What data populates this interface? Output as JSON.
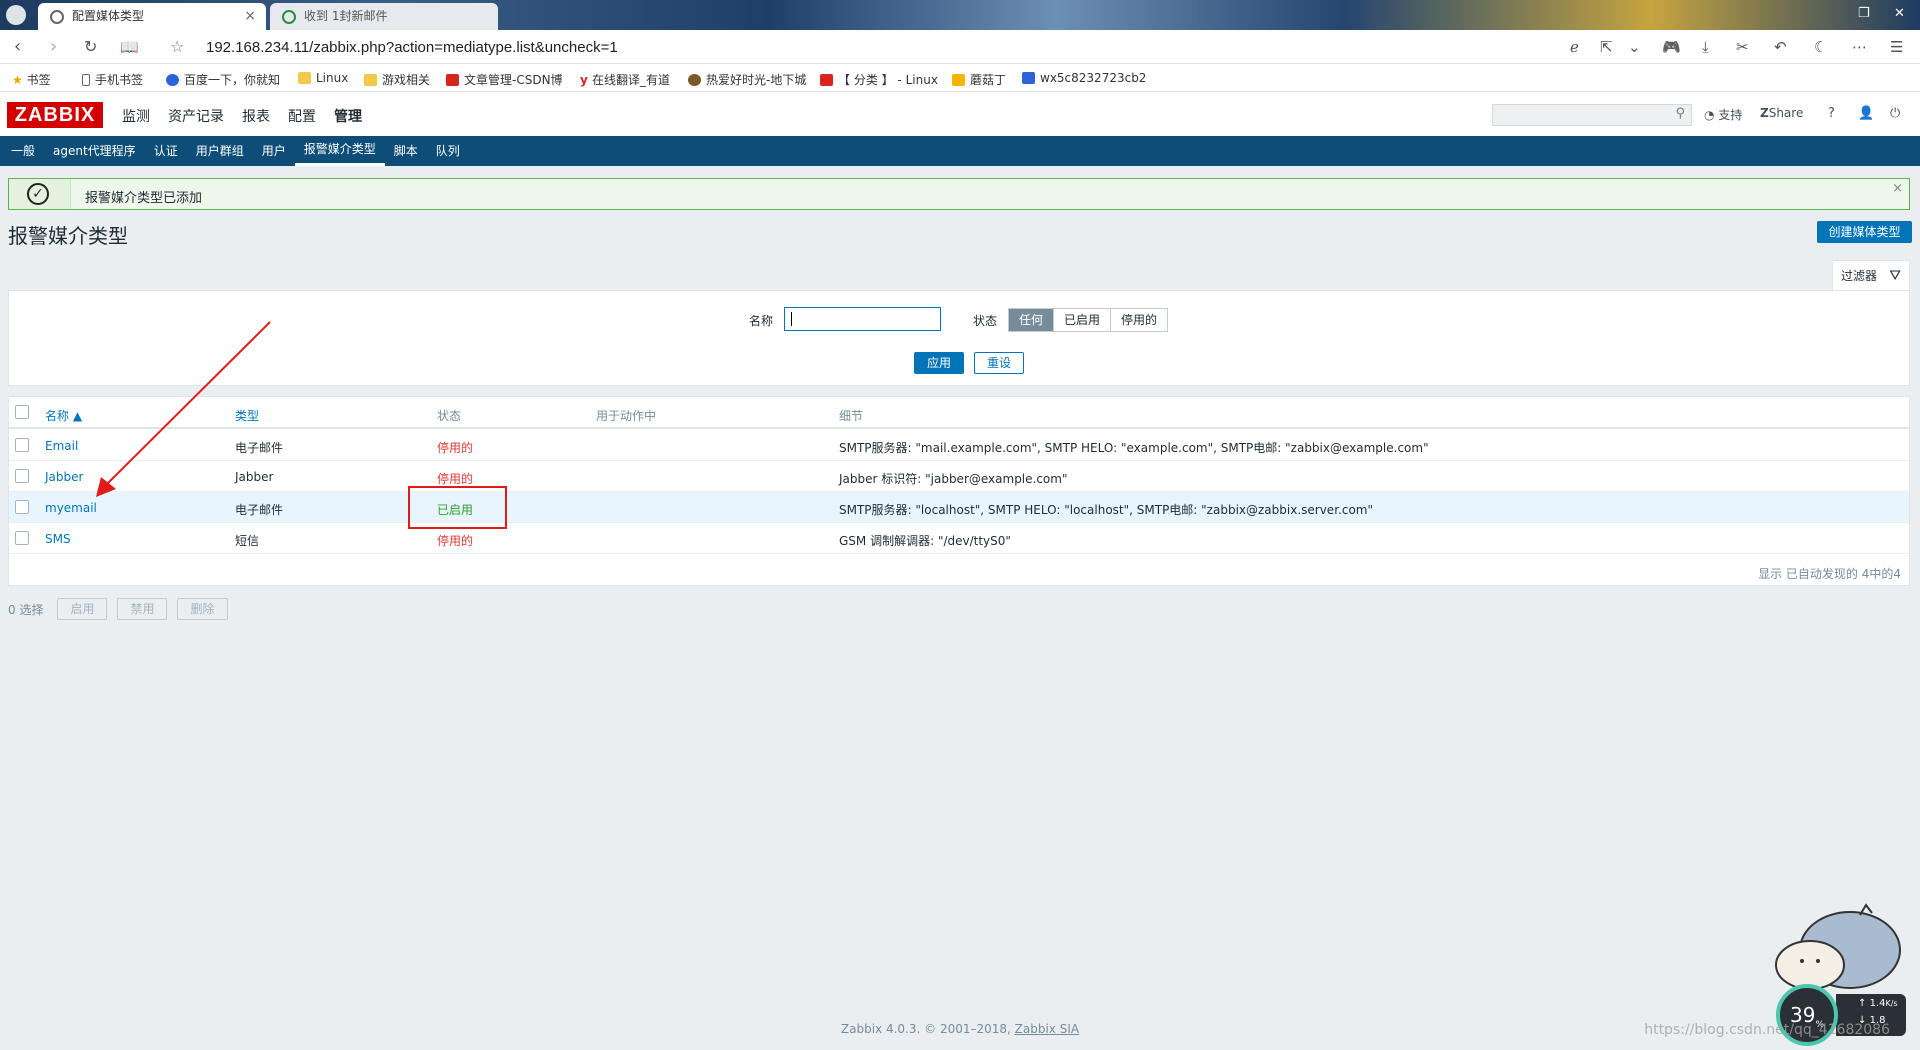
{
  "browser": {
    "tabs": [
      {
        "title": "配置媒体类型",
        "active": true
      },
      {
        "title": "收到 1封新邮件",
        "active": false
      }
    ],
    "url": "192.168.234.11/zabbix.php?action=mediatype.list&uncheck=1",
    "bookmarks": [
      "书签",
      "手机书签",
      "百度一下，你就知",
      "Linux",
      "游戏相关",
      "文章管理-CSDN博",
      "在线翻译_有道",
      "热爱好时光-地下城",
      "【 分类 】 - Linux",
      "蘑菇丁",
      "wx5c8232723cb2"
    ]
  },
  "header": {
    "logo": "ZABBIX",
    "menu": [
      "监测",
      "资产记录",
      "报表",
      "配置",
      "管理"
    ],
    "menu_selected": "管理",
    "support": "支持",
    "share": "Share",
    "help": "?"
  },
  "submenu": {
    "items": [
      "一般",
      "agent代理程序",
      "认证",
      "用户群组",
      "用户",
      "报警媒介类型",
      "脚本",
      "队列"
    ],
    "selected": "报警媒介类型"
  },
  "message": {
    "text": "报警媒介类型已添加",
    "close": "×"
  },
  "page": {
    "title": "报警媒介类型",
    "create_button": "创建媒体类型"
  },
  "filter": {
    "tab_label": "过滤器",
    "name_label": "名称",
    "name_value": "",
    "status_label": "状态",
    "status_options": [
      "任何",
      "已启用",
      "停用的"
    ],
    "status_selected": "任何",
    "apply": "应用",
    "reset": "重设"
  },
  "table": {
    "headers": {
      "name": "名称 ▲",
      "type": "类型",
      "status": "状态",
      "used_in": "用于动作中",
      "details": "细节"
    },
    "rows": [
      {
        "name": "Email",
        "type": "电子邮件",
        "status": "停用的",
        "enabled": false,
        "details": "SMTP服务器: \"mail.example.com\", SMTP HELO: \"example.com\", SMTP电邮: \"zabbix@example.com\""
      },
      {
        "name": "Jabber",
        "type": "Jabber",
        "status": "停用的",
        "enabled": false,
        "details": "Jabber 标识符: \"jabber@example.com\""
      },
      {
        "name": "myemail",
        "type": "电子邮件",
        "status": "已启用",
        "enabled": true,
        "details": "SMTP服务器: \"localhost\", SMTP HELO: \"localhost\", SMTP电邮: \"zabbix@zabbix.server.com\""
      },
      {
        "name": "SMS",
        "type": "短信",
        "status": "停用的",
        "enabled": false,
        "details": "GSM 调制解调器: \"/dev/ttyS0\""
      }
    ],
    "footer": "显示 已自动发现的 4中的4"
  },
  "actions": {
    "selected_count": "0 选择",
    "enable": "启用",
    "disable": "禁用",
    "delete": "删除"
  },
  "footer": {
    "text": "Zabbix 4.0.3. © 2001–2018, ",
    "link": "Zabbix SIA"
  },
  "overlay": {
    "speed_percent": "39",
    "speed_unit": "%",
    "speed_up": "1.4",
    "speed_up_unit": "K/s",
    "speed_down": "1.8",
    "watermark": "https://blog.csdn.net/qq_41682086"
  },
  "colors": {
    "zabbix_red": "#d40000",
    "nav_blue": "#0d4d77",
    "link_blue": "#0275b8",
    "disabled_red": "#e33734",
    "enabled_green": "#2f9f2f",
    "annotation_red": "#e11a1a"
  }
}
